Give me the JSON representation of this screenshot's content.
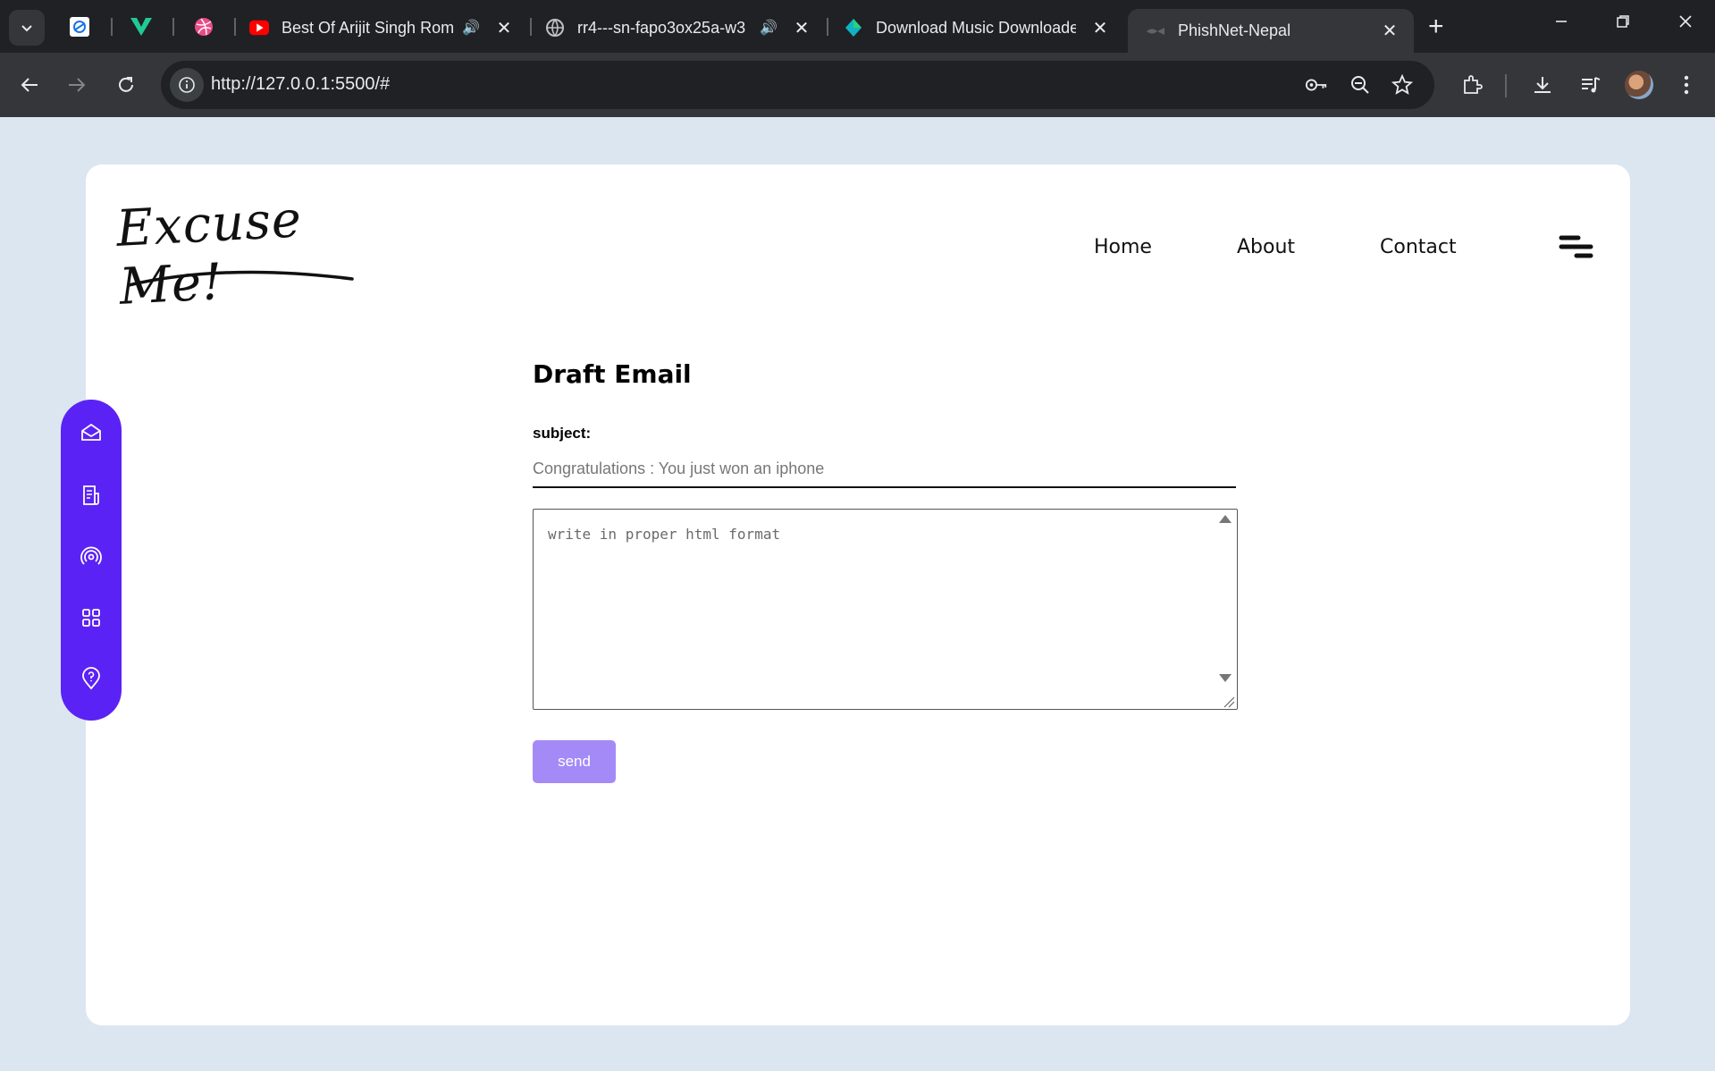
{
  "browser": {
    "tabs": [
      {
        "title": "Best Of Arijit Singh Rom",
        "audio": "🔊"
      },
      {
        "title": "rr4---sn-fapo3ox25a-w3",
        "audio": "🔊"
      },
      {
        "title": "Download Music Downloade"
      },
      {
        "title": "PhishNet-Nepal",
        "active": true
      }
    ],
    "close_glyph": "✕",
    "new_tab_glyph": "+",
    "url": "http://127.0.0.1:5500/#"
  },
  "page": {
    "logo_text": "Excuse Me!",
    "nav": {
      "home": "Home",
      "about": "About",
      "contact": "Contact"
    },
    "sidebar_icons": [
      "mail-icon",
      "document-icon",
      "broadcast-icon",
      "grid-icon",
      "location-help-icon"
    ],
    "form": {
      "title": "Draft Email",
      "subject_label": "subject:",
      "subject_placeholder": "Congratulations : You just won an iphone",
      "body_placeholder": "write in proper html format",
      "send_label": "send"
    },
    "colors": {
      "sidebar": "#5b22f5",
      "send_button": "#a48af7",
      "page_background": "#dce6f1"
    }
  }
}
